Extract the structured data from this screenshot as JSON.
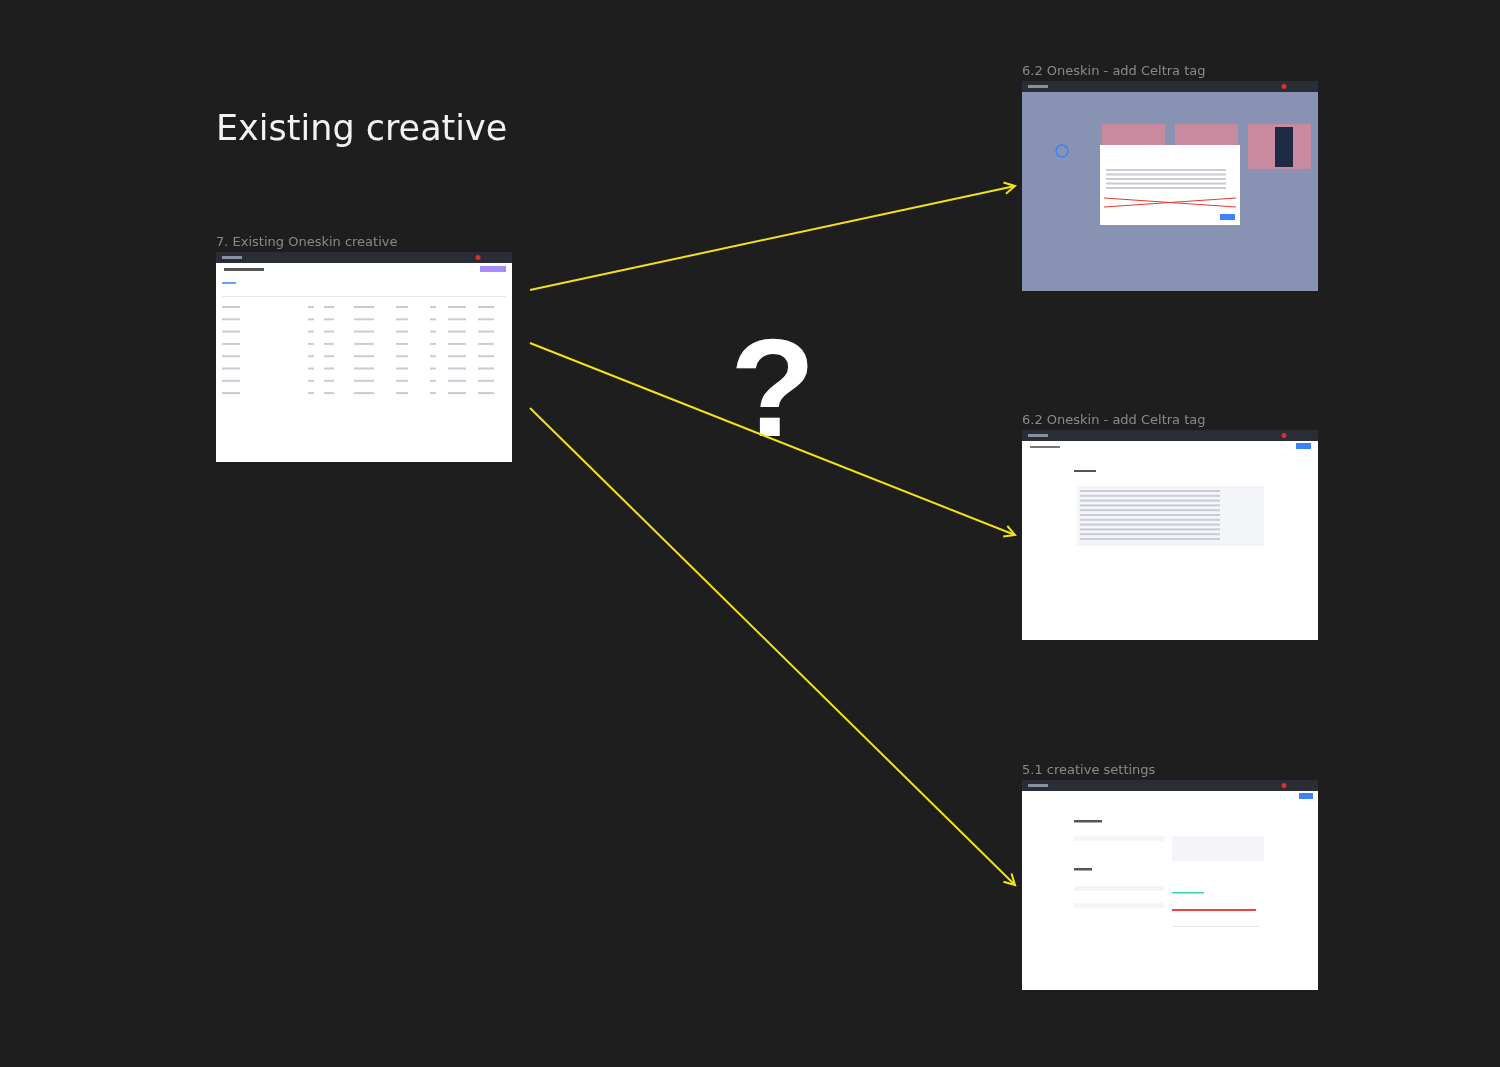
{
  "canvas_title": "Existing creative",
  "question_mark": "?",
  "frames": [
    {
      "title": "7. Existing Oneskin creative",
      "kind": "table"
    },
    {
      "title": "6.2 Oneskin - add Celtra tag",
      "kind": "modal"
    },
    {
      "title": "6.2 Oneskin - add Celtra tag",
      "kind": "code"
    },
    {
      "title": "5.1 creative settings",
      "kind": "form"
    }
  ]
}
